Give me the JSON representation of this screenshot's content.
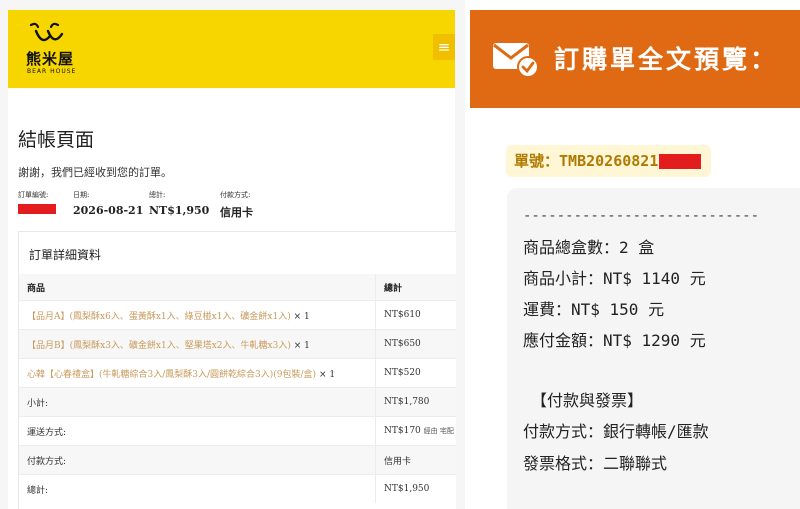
{
  "checkout": {
    "logo_name": "熊米屋",
    "logo_sub": "BEAR HOUSE",
    "menu_icon": "hamburger-icon",
    "title": "結帳頁面",
    "thanks": "謝謝，我們已經收到您的訂單。",
    "meta": {
      "order_number_label": "訂單編號:",
      "date_label": "日期:",
      "date": "2026-08-21",
      "total_label": "總計:",
      "total": "NT$1,950",
      "payment_label": "付款方式:",
      "payment": "信用卡"
    },
    "details_title": "訂單詳細資料",
    "columns": {
      "product": "商品",
      "total": "總計"
    },
    "items": [
      {
        "name": "【品月A】(鳳梨酥x6入、蛋黃酥x1入、綠豆椪x1入、礦金餅x1入)",
        "qty": "× 1",
        "total": "NT$610"
      },
      {
        "name": "【品月B】(鳳梨酥x3入、礦金餅x1入、堅果塔x2入、牛軋糖x3入)",
        "qty": "× 1",
        "total": "NT$650"
      },
      {
        "name": "心韓【心春禮盒】(牛軋糖綜合3入/鳳梨酥3入/圓餅乾綜合3入)(9包裝/盒)",
        "qty": "× 1",
        "total": "NT$520"
      }
    ],
    "summary": [
      {
        "label": "小計:",
        "value": "NT$1,780",
        "note": ""
      },
      {
        "label": "運送方式:",
        "value": "NT$170",
        "note": "經由 宅配"
      },
      {
        "label": "付款方式:",
        "value": "信用卡",
        "note": ""
      },
      {
        "label": "總計:",
        "value": "NT$1,950",
        "note": ""
      }
    ]
  },
  "preview": {
    "icon": "envelope-check-icon",
    "banner_title": "訂購單全文預覽：",
    "order_no_label": "單號：",
    "order_no": "TMB20260821",
    "divider": "----------------------------",
    "lines": {
      "boxes": "商品總盒數：2 盒",
      "subtotal": "商品小計：NT$ 1140 元",
      "shipping": "運費：NT$ 150 元",
      "amount_due": "應付金額：NT$ 1290 元",
      "section": "【付款與發票】",
      "pay_method": "付款方式：銀行轉帳/匯款",
      "invoice": "發票格式：二聯聯式"
    }
  },
  "colors": {
    "header_yellow": "#f7d600",
    "banner_orange": "#e06a14",
    "redaction": "#e31d1d",
    "product_link": "#c99a5c",
    "order_no_text": "#b07a00"
  }
}
